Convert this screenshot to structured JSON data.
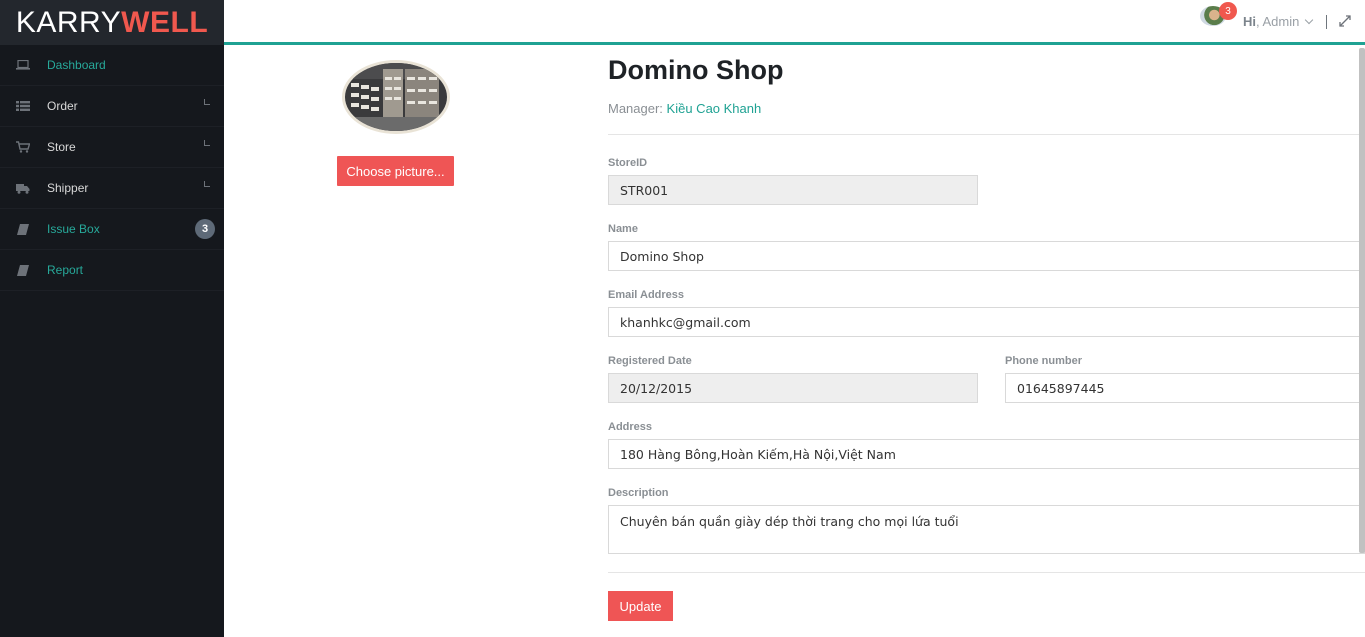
{
  "brand": {
    "part1": "KARRY",
    "part2": "WELL"
  },
  "sidebar": {
    "items": [
      {
        "label": "Dashboard",
        "icon": "laptop-icon",
        "active": true
      },
      {
        "label": "Order",
        "icon": "list-icon",
        "arrow": true
      },
      {
        "label": "Store",
        "icon": "cart-icon",
        "arrow": true
      },
      {
        "label": "Shipper",
        "icon": "truck-icon",
        "arrow": true
      },
      {
        "label": "Issue Box",
        "icon": "book-icon",
        "badge": "3",
        "active": true
      },
      {
        "label": "Report",
        "icon": "book-icon",
        "active": true
      }
    ]
  },
  "header": {
    "notification_count": "3",
    "greeting_hi": "Hi",
    "greeting_name": ", Admin"
  },
  "profile": {
    "choose_picture_label": "Choose picture..."
  },
  "store": {
    "title": "Domino Shop",
    "manager_label": "Manager: ",
    "manager_name": "Kiều Cao Khanh"
  },
  "form": {
    "store_id": {
      "label": "StoreID",
      "value": "STR001"
    },
    "name": {
      "label": "Name",
      "value": "Domino Shop"
    },
    "email": {
      "label": "Email Address",
      "value": "khanhkc@gmail.com"
    },
    "registered_date": {
      "label": "Registered Date",
      "value": "20/12/2015"
    },
    "phone": {
      "label": "Phone number",
      "value": "01645897445"
    },
    "address": {
      "label": "Address",
      "value": "180 Hàng Bông,Hoàn Kiếm,Hà Nội,Việt Nam"
    },
    "description": {
      "label": "Description",
      "value": "Chuyên bán quần giày dép thời trang cho mọi lứa tuổi"
    },
    "update_label": "Update"
  },
  "colors": {
    "accent": "#1fa293",
    "danger": "#ef5555",
    "sidebar_bg": "#15181d"
  }
}
